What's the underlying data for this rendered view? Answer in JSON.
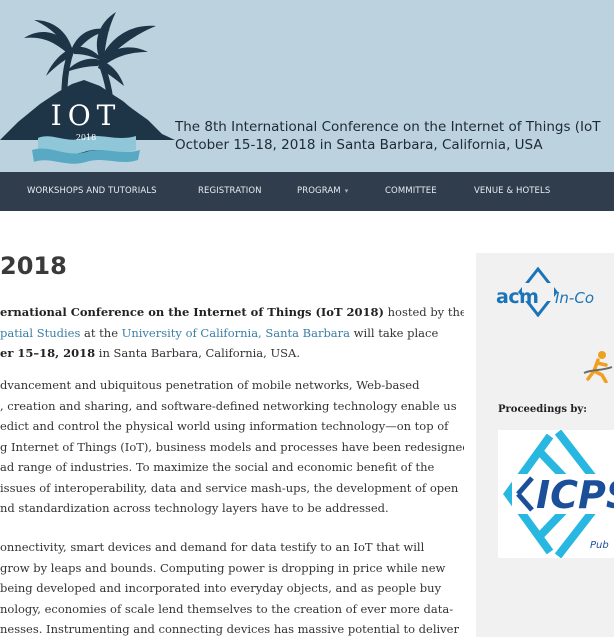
{
  "header": {
    "logo_text": "IOT",
    "logo_year": "2018",
    "title_line1": "The 8th International Conference on the Internet of Things (IoT",
    "title_line2": "October 15-18, 2018 in Santa Barbara, California, USA"
  },
  "nav": {
    "items": [
      {
        "label": "WORKSHOPS AND TUTORIALS"
      },
      {
        "label": "REGISTRATION"
      },
      {
        "label": "PROGRAM",
        "caret": "▾"
      },
      {
        "label": "COMMITTEE"
      },
      {
        "label": "VENUE & HOTELS"
      }
    ]
  },
  "main": {
    "title": "2018",
    "p1": {
      "l1_bold": "ernational Conference on the Internet of Things (IoT 2018)",
      "l1_rest": " hosted by the",
      "l2_link1": "patial Studies",
      "l2_mid": " at the ",
      "l2_link2": "University of California, Santa Barbara",
      "l2_rest": " will take place",
      "l3_bold": "er 15–18, 2018",
      "l3_rest": " in Santa Barbara, California, USA."
    },
    "p2": [
      "dvancement and ubiquitous penetration of mobile networks, Web-based",
      ", creation and sharing, and software-defined networking technology enable us",
      "edict and control the physical world using information technology—on top of",
      "g Internet of Things (IoT), business models and processes have been redesigned",
      "ad range of industries. To maximize the social and economic benefit of the",
      "issues of interoperability, data and service mash-ups, the development of open",
      "nd standardization across technology layers have to be addressed."
    ],
    "p3": [
      "onnectivity, smart devices and demand for data testify to an IoT that will",
      "grow by leaps and bounds. Computing power is dropping in price while new",
      "being developed and incorporated into everyday objects, and as people buy",
      "nology, economies of scale lend themselves to the creation of ever more data-",
      "nesses. Instrumenting and connecting devices has massive potential to deliver"
    ]
  },
  "sidebar": {
    "acm": "acm",
    "in_cooperation": "In-Co",
    "proceedings_label": "Proceedings by:",
    "icps_text": "ICPS",
    "icps_sub": "Pub"
  },
  "colors": {
    "banner": "#bcd3df",
    "nav": "#2f3d4c",
    "link": "#3b7ea6",
    "acm_blue": "#1b74b8",
    "icps_cyan": "#27b7e0"
  }
}
